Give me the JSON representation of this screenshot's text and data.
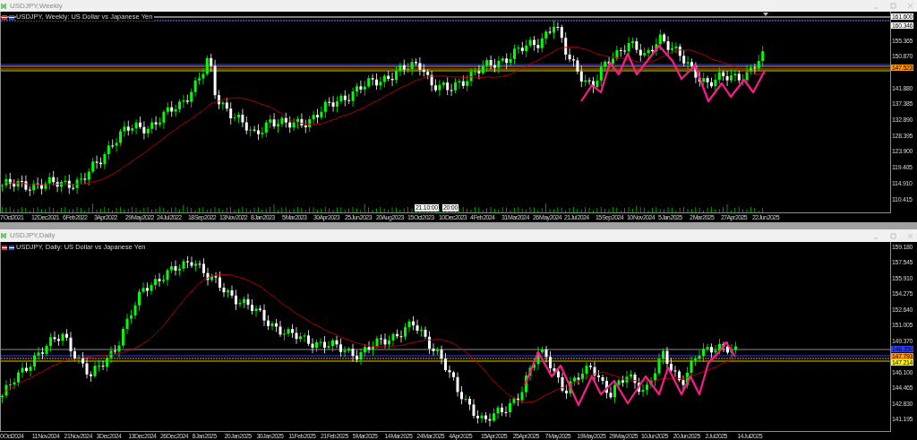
{
  "windows": [
    {
      "title": "USDJPY,Weekly",
      "chart_label": "USDJPY, Weekly: US Dollar vs Japanese Yen",
      "price_ticks": [
        "155.365",
        "150.870",
        "141.880",
        "137.385",
        "132.890",
        "128.395",
        "123.900",
        "119.405",
        "114.910",
        "110.415"
      ],
      "price_tags": [
        {
          "text": "161.600",
          "color": "#ffffff"
        },
        {
          "text": "160.346",
          "color": "#ffffff"
        },
        {
          "text": "147.523",
          "color": "#ff9900"
        }
      ],
      "time_ticks": [
        "7 Oct 2021",
        "12 Dec 2021",
        "6 Feb 2022",
        "3 Apr 2022",
        "29 May 2022",
        "24 Jul 2022",
        "18 Sep 2022",
        "13 Nov 2022",
        "8 Jan 2023",
        "5 Mar 2023",
        "30 Apr 2023",
        "25 Jun 2023",
        "20 Aug 2023",
        "15 Oct 2023",
        "10 Dec 2023",
        "4 Feb 2024",
        "31 Mar 2024",
        "26 May 2024",
        "21 Jul 2024",
        "15 Sep 2024",
        "10 Nov 2024",
        "5 Jan 2025",
        "2 Mar 2025",
        "27 Apr 2025",
        "22 Jun 2025"
      ],
      "time_markers": [
        "21.10:00",
        "20:00"
      ]
    },
    {
      "title": "USDJPY,Daily",
      "chart_label": "USDJPY, Daily: US Dollar vs Japanese Yen",
      "price_ticks": [
        "159.180",
        "157.545",
        "155.910",
        "154.275",
        "152.640",
        "151.005",
        "149.370",
        "146.100",
        "144.465",
        "142.830",
        "141.195"
      ],
      "price_tags": [
        {
          "text": "148.350",
          "color": "#3040ff"
        },
        {
          "text": "147.793",
          "color": "#ff9900"
        },
        {
          "text": "147.214",
          "color": "#ffff00"
        }
      ],
      "time_ticks": [
        "0 Oct 2024",
        "11 Nov 2024",
        "21 Nov 2024",
        "3 Dec 2024",
        "13 Dec 2024",
        "26 Dec 2024",
        "8 Jan 2025",
        "20 Jan 2025",
        "30 Jan 2025",
        "11 Feb 2025",
        "21 Feb 2025",
        "5 Mar 2025",
        "14 Mar 2025",
        "24 Mar 2025",
        "4 Apr 2025",
        "15 Apr 2025",
        "25 Apr 2025",
        "7 May 2025",
        "19 May 2025",
        "29 May 2025",
        "10 Jun 2025",
        "20 Jun 2025",
        "2 Jul 2025",
        "14 Jul 2025"
      ]
    }
  ]
}
